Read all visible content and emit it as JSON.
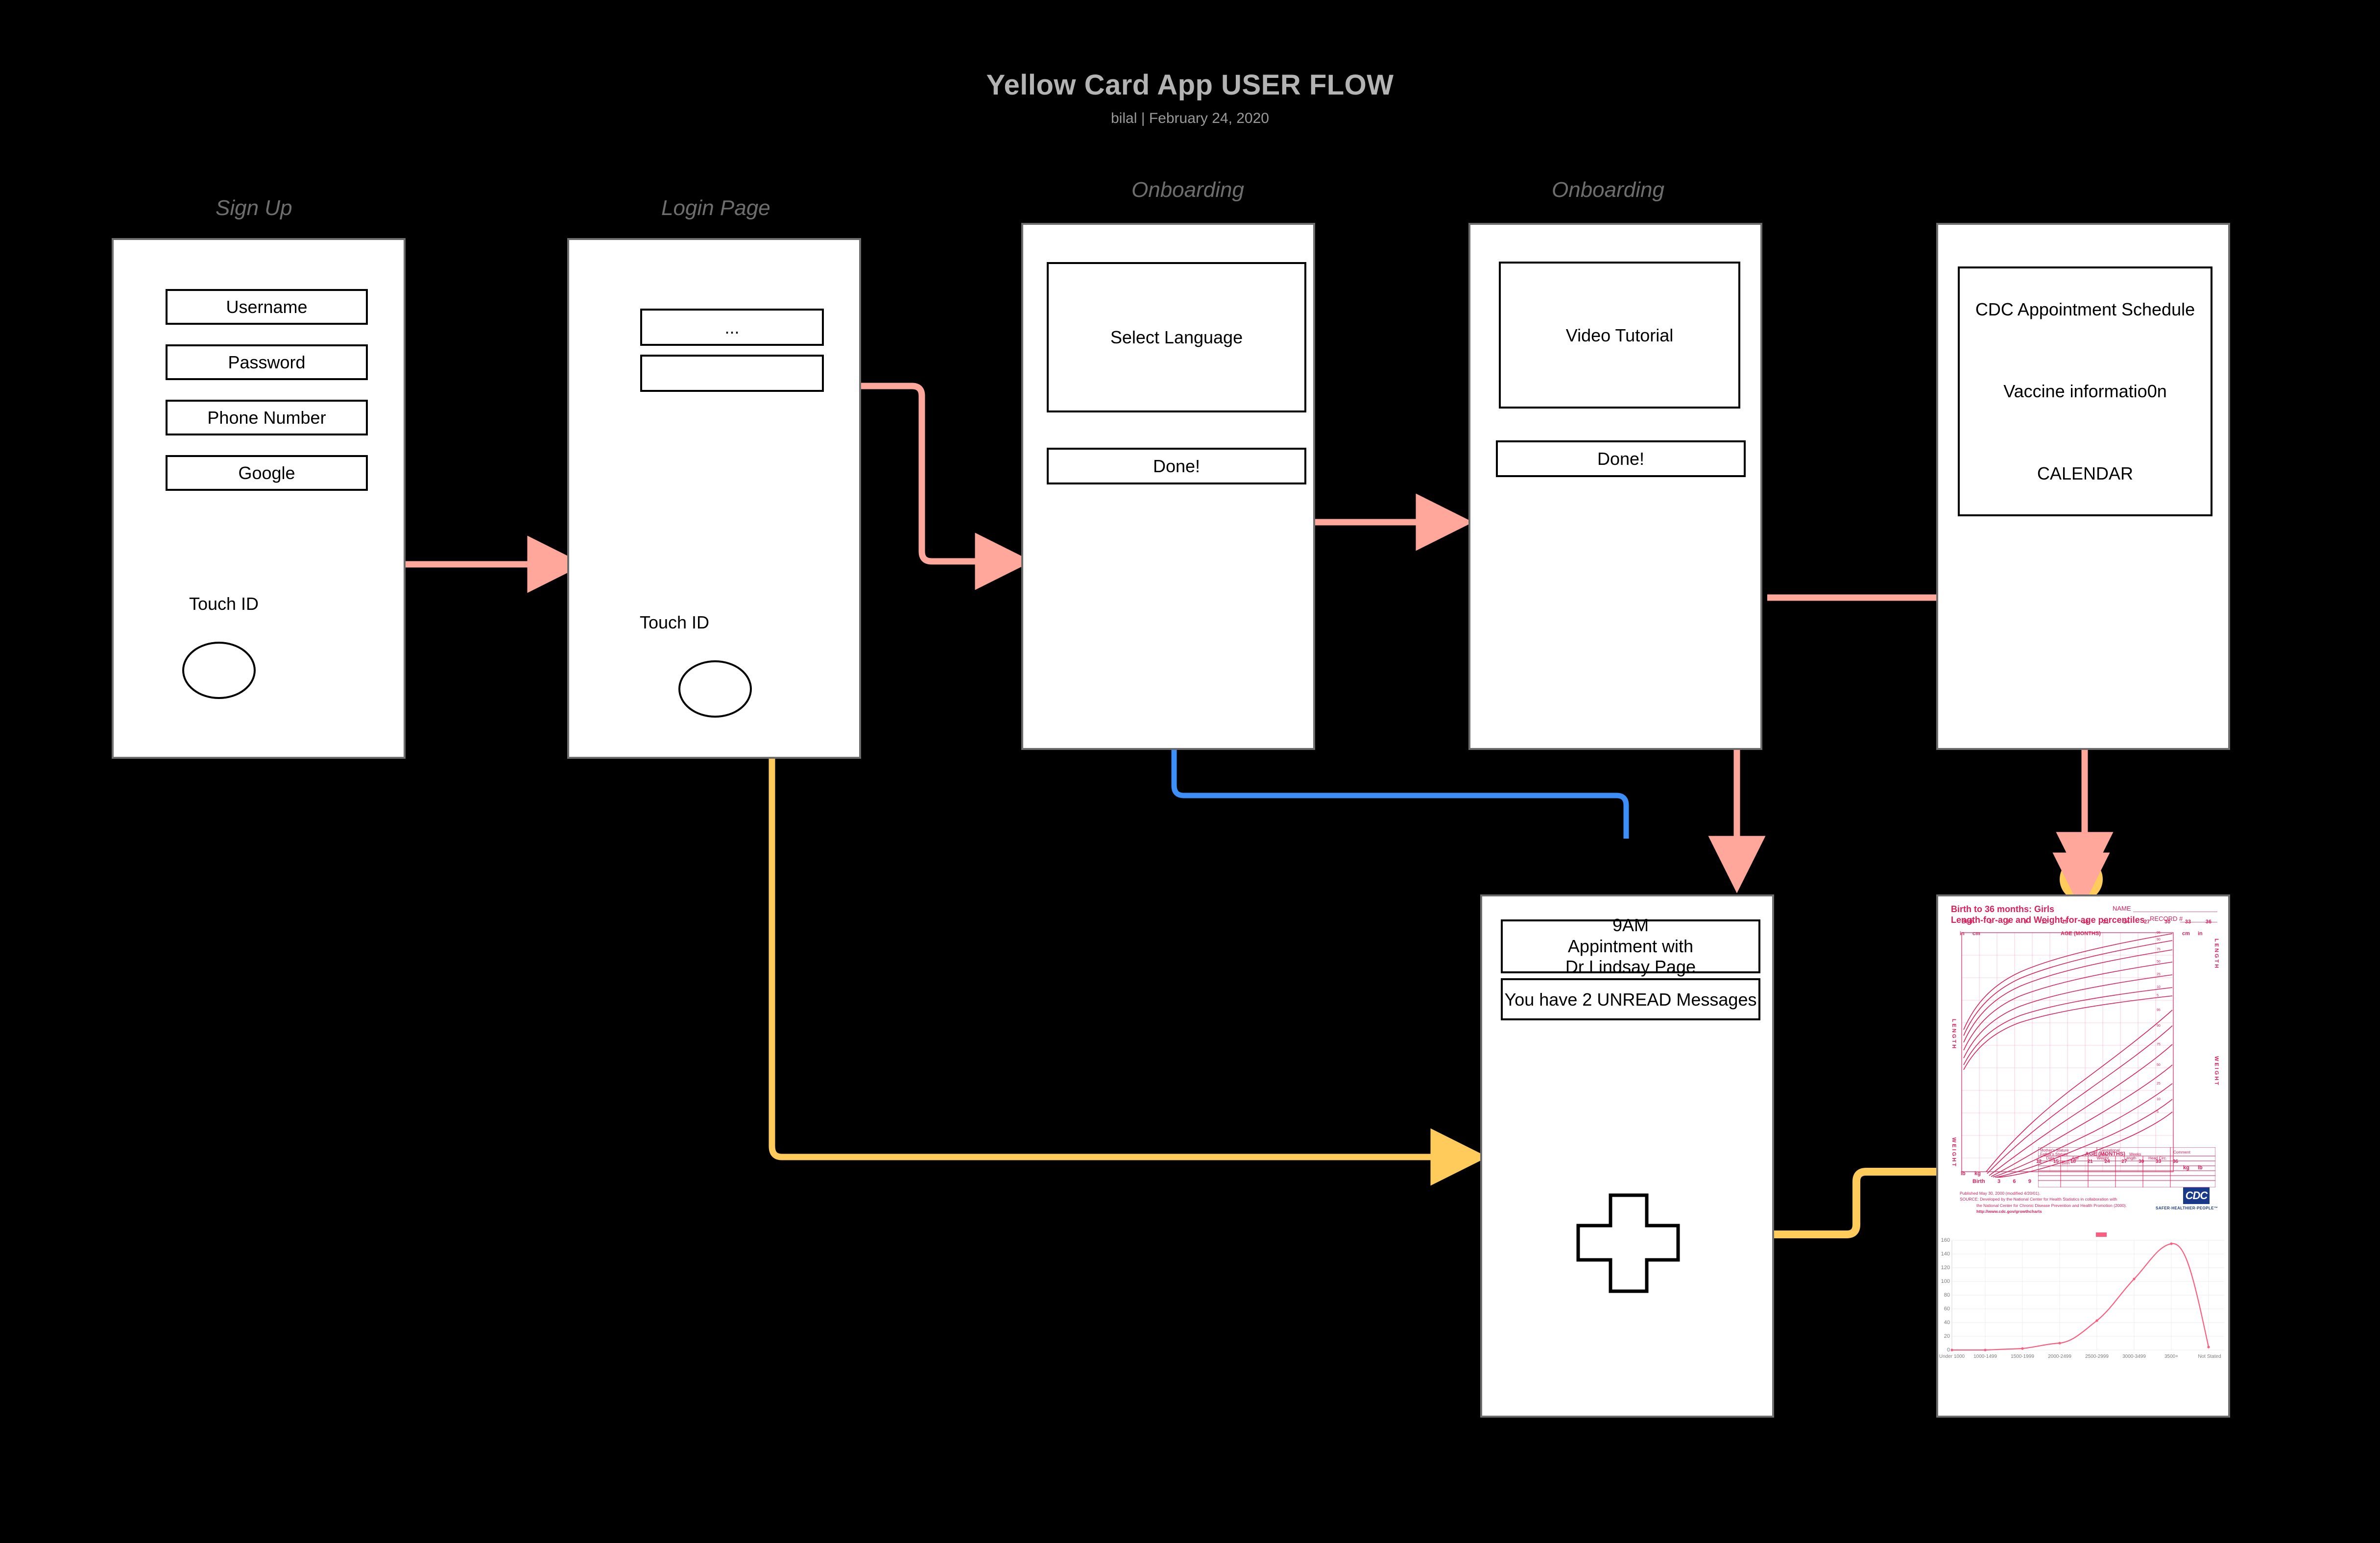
{
  "header": {
    "title": "Yellow Card App USER FLOW",
    "subtitle": "bilal   |  February 24, 2020"
  },
  "colors": {
    "background": "#000000",
    "screen_border": "#6d6d6d",
    "label": "#6e6e6e",
    "connector_pink": "#ffa79a",
    "connector_yellow": "#ffcc5c",
    "connector_blue": "#3d8ef7",
    "chart_pink": "#fb5e7e",
    "cdc_magenta": "#d9215b",
    "cdc_blue": "#19398a"
  },
  "screens": [
    {
      "id": "signup",
      "label": "Sign Up",
      "fields": [
        "Username",
        "Password",
        "Phone Number",
        "Google"
      ],
      "touch_label": "Touch ID",
      "has_touch_circle": true
    },
    {
      "id": "login",
      "label": "Login Page",
      "fields": [
        "...",
        ""
      ],
      "touch_label": "Touch ID",
      "has_touch_circle": true
    },
    {
      "id": "onboarding-language",
      "label": "Onboarding",
      "panel_text": "Select Language",
      "button_text": "Done!"
    },
    {
      "id": "onboarding-video",
      "label": "Onboarding",
      "panel_text": "Video Tutorial",
      "button_text": "Done!"
    },
    {
      "id": "cdc-schedule",
      "label": "",
      "lines": [
        "CDC Appointment Schedule",
        "Vaccine  informatio0n",
        "CALENDAR"
      ]
    },
    {
      "id": "appointment-dashboard",
      "label": "",
      "appointment_lines": [
        "9AM",
        "Appintment  with",
        "Dr  Lindsay  Page"
      ],
      "messages_text": "You have  2 UNREAD Messages",
      "icon": "medical-cross-icon"
    },
    {
      "id": "growth-chart",
      "label": ""
    }
  ],
  "growth_chart": {
    "title_line1": "Birth to 36 months: Girls",
    "title_line2": "Length-for-age and Weight-for-age percentiles",
    "name_label": "NAME",
    "record_label": "RECORD #",
    "age_axis_label": "AGE (MONTHS)",
    "age_ticks": [
      "Birth",
      "3",
      "6",
      "9",
      "12",
      "15",
      "18",
      "21",
      "24",
      "27",
      "30",
      "33",
      "36"
    ],
    "age_ticks_lower": [
      "12",
      "15",
      "18",
      "21",
      "24",
      "27",
      "30",
      "33",
      "36"
    ],
    "age_ticks_bottom": [
      "Birth",
      "3",
      "6",
      "9"
    ],
    "unit_in": "in",
    "unit_cm": "cm",
    "unit_lb": "lb",
    "unit_kg": "kg",
    "side_length": "LENGTH",
    "side_weight": "WEIGHT",
    "length_in_ticks": [
      "41",
      "40",
      "39",
      "38",
      "37",
      "36",
      "35",
      "34",
      "33",
      "32",
      "31",
      "30",
      "29",
      "28",
      "27",
      "26",
      "25",
      "24",
      "23",
      "22",
      "21",
      "20",
      "19",
      "18",
      "17",
      "16",
      "15"
    ],
    "length_cm_ticks": [
      "100",
      "95",
      "90",
      "85",
      "80",
      "75",
      "70",
      "65",
      "60",
      "55",
      "50",
      "45",
      "40"
    ],
    "weight_kg_ticks": [
      "17",
      "16",
      "15",
      "14",
      "13",
      "12",
      "11",
      "10",
      "9",
      "8",
      "7",
      "6",
      "5",
      "4",
      "3",
      "2"
    ],
    "weight_lb_ticks": [
      "38",
      "36",
      "34",
      "32",
      "30",
      "28",
      "26",
      "24",
      "22",
      "20",
      "18",
      "16",
      "14",
      "12",
      "10",
      "8",
      "6"
    ],
    "percentile_labels": [
      "95",
      "90",
      "75",
      "50",
      "25",
      "10",
      "5"
    ],
    "form_headers": [
      "Date",
      "Age",
      "Weight",
      "Length",
      "Head  Circ."
    ],
    "form_first_row": "Birth",
    "form_fields": [
      "Mother's Stature",
      "Father's Stature",
      "Gestational",
      "Age:",
      "Weeks",
      "Comment"
    ],
    "source_lines": [
      "Published May 30, 2000 (modified 4/20/01).",
      "SOURCE: Developed by the National Center for Health Statistics in collaboration with",
      "the National Center for Chronic Disease Prevention and Health Promotion (2000).",
      "http://www.cdc.gov/growthcharts"
    ],
    "cdc_logo_text": "CDC",
    "cdc_tagline": "SAFER·HEALTHIER·PEOPLE™"
  },
  "chart_data": {
    "type": "line",
    "title": "",
    "xlabel": "",
    "ylabel": "",
    "categories": [
      "Under 1000",
      "1000-1499",
      "1500-1999",
      "2000-2499",
      "2500-2999",
      "3000-3499",
      "3500+",
      "Not Stated"
    ],
    "values": [
      0,
      0,
      2,
      10,
      43,
      104,
      152,
      4
    ],
    "ylim": [
      0,
      160
    ],
    "yticks": [
      0,
      20,
      40,
      60,
      80,
      100,
      120,
      140,
      160
    ],
    "grid": true,
    "legend_position": "top-center",
    "series_color": "#fb5e7e"
  },
  "connectors": [
    {
      "id": "signup-to-login",
      "color": "#ffa79a",
      "from": "signup",
      "to": "login"
    },
    {
      "id": "login-to-onboarding-language",
      "color": "#ffa79a",
      "from": "login",
      "to": "onboarding-language"
    },
    {
      "id": "language-to-video",
      "color": "#ffa79a",
      "from": "onboarding-language",
      "to": "onboarding-video"
    },
    {
      "id": "video-to-cdc-schedule",
      "color": "#ffa79a",
      "from": "onboarding-video",
      "to": "cdc-schedule"
    },
    {
      "id": "video-to-appointment",
      "color": "#ffa79a",
      "from": "onboarding-video",
      "to": "appointment-dashboard"
    },
    {
      "id": "cdc-schedule-to-growth-chart",
      "color": "#ffa79a",
      "from": "cdc-schedule",
      "to": "growth-chart"
    },
    {
      "id": "login-touch-to-appointment",
      "color": "#ffcc5c",
      "from": "login",
      "to": "appointment-dashboard"
    },
    {
      "id": "appointment-to-growth-chart",
      "color": "#ffcc5c",
      "from": "appointment-dashboard",
      "to": "growth-chart"
    },
    {
      "id": "appointment-to-onboarding-language",
      "color": "#3d8ef7",
      "from": "appointment-dashboard",
      "to": "onboarding-language"
    }
  ]
}
